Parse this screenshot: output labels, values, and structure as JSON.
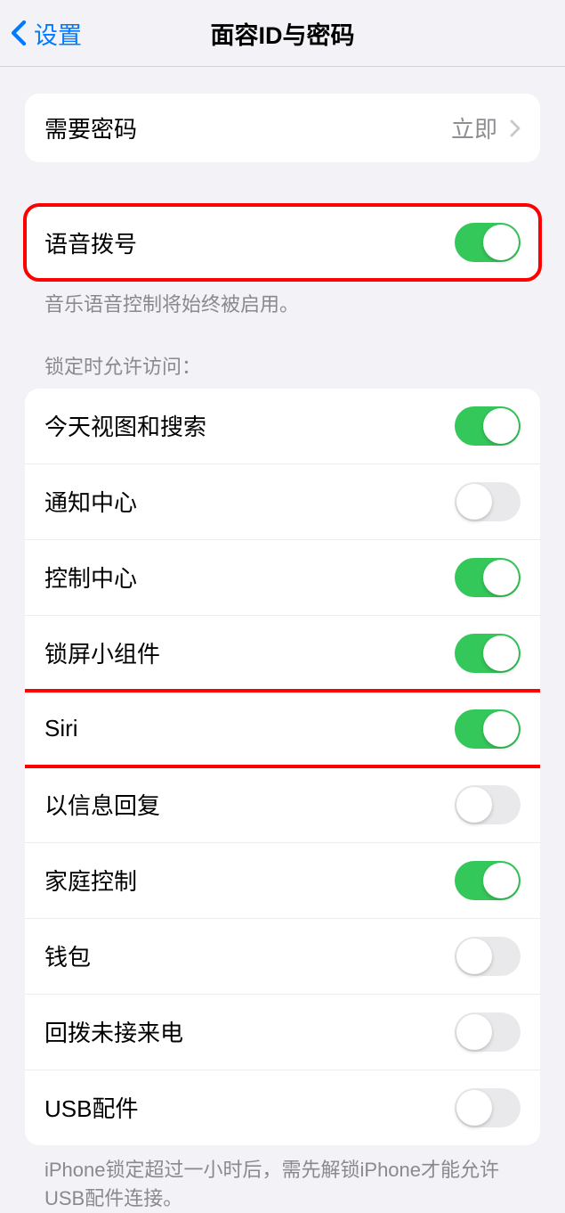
{
  "header": {
    "back_label": "设置",
    "title": "面容ID与密码"
  },
  "require_passcode": {
    "label": "需要密码",
    "value": "立即"
  },
  "voice_dial": {
    "label": "语音拨号",
    "enabled": true,
    "footer": "音乐语音控制将始终被启用。"
  },
  "lock_access": {
    "header": "锁定时允许访问：",
    "items": [
      {
        "label": "今天视图和搜索",
        "enabled": true
      },
      {
        "label": "通知中心",
        "enabled": false
      },
      {
        "label": "控制中心",
        "enabled": true
      },
      {
        "label": "锁屏小组件",
        "enabled": true
      },
      {
        "label": "Siri",
        "enabled": true
      },
      {
        "label": "以信息回复",
        "enabled": false
      },
      {
        "label": "家庭控制",
        "enabled": true
      },
      {
        "label": "钱包",
        "enabled": false
      },
      {
        "label": "回拨未接来电",
        "enabled": false
      },
      {
        "label": "USB配件",
        "enabled": false
      }
    ],
    "footer": "iPhone锁定超过一小时后，需先解锁iPhone才能允许USB配件连接。"
  },
  "highlights": [
    "voice-dial-row",
    "lock-item-siri"
  ]
}
